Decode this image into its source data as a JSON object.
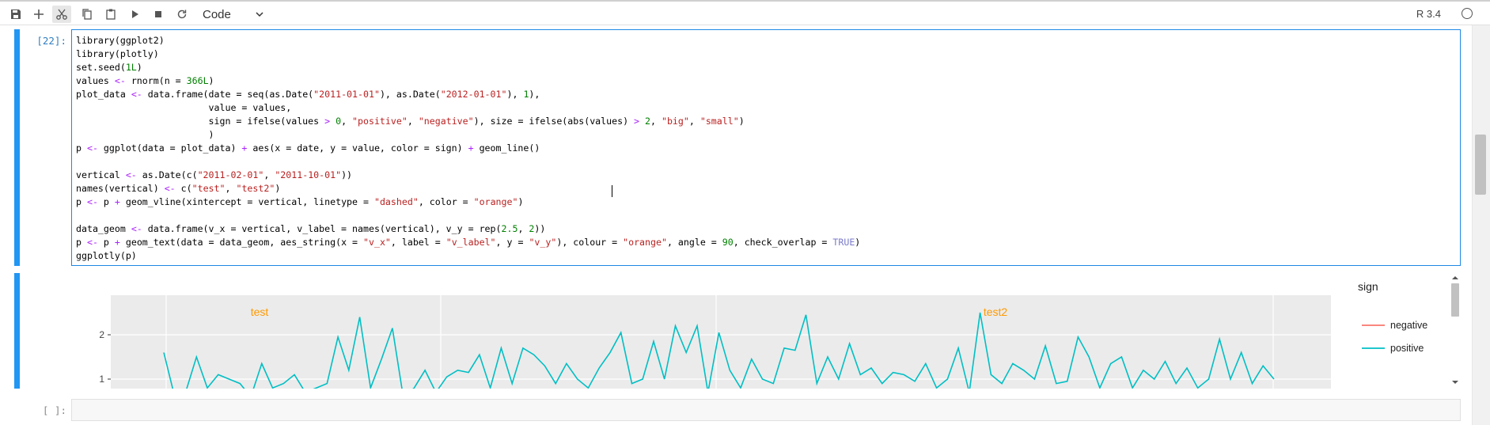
{
  "toolbar": {
    "buttons": [
      {
        "name": "save-icon"
      },
      {
        "name": "add-cell-icon"
      },
      {
        "name": "cut-icon"
      },
      {
        "name": "copy-icon"
      },
      {
        "name": "paste-icon"
      },
      {
        "name": "run-icon"
      },
      {
        "name": "stop-icon"
      },
      {
        "name": "restart-icon"
      }
    ],
    "cell_type": "Code",
    "kernel": "R 3.4"
  },
  "cells": [
    {
      "prompt": "[22]:",
      "code": [
        "library(ggplot2)",
        "library(plotly)",
        "set.seed(1L)",
        "values <- rnorm(n = 366L)",
        "plot_data <- data.frame(date = seq(as.Date(\"2011-01-01\"), as.Date(\"2012-01-01\"), 1),",
        "                        value = values,",
        "                        sign = ifelse(values > 0, \"positive\", \"negative\"), size = ifelse(abs(values) > 2, \"big\", \"small\")",
        "                        )",
        "p <- ggplot(data = plot_data) + aes(x = date, y = value, color = sign) + geom_line()",
        "",
        "vertical <- as.Date(c(\"2011-02-01\", \"2011-10-01\"))",
        "names(vertical) <- c(\"test\", \"test2\")",
        "p <- p + geom_vline(xintercept = vertical, linetype = \"dashed\", color = \"orange\")",
        "",
        "data_geom <- data.frame(v_x = vertical, v_label = names(vertical), v_y = rep(2.5, 2))",
        "p <- p + geom_text(data = data_geom, aes_string(x = \"v_x\", label = \"v_label\", y = \"v_y\"), colour = \"orange\", angle = 90, check_overlap = TRUE)",
        "ggplotly(p)"
      ]
    },
    {
      "prompt": "[ ]:"
    }
  ],
  "chart_data": {
    "type": "line",
    "legend_title": "sign",
    "legend_position": "right",
    "y_ticks": [
      1,
      2
    ],
    "series": [
      {
        "name": "negative",
        "color": "#f8766d",
        "values": []
      },
      {
        "name": "positive",
        "color": "#00bfc4",
        "values": [
          1.6,
          0.6,
          0.7,
          1.5,
          0.8,
          1.1,
          1.0,
          0.9,
          0.6,
          1.35,
          0.8,
          0.9,
          1.1,
          0.7,
          0.8,
          0.9,
          1.95,
          1.2,
          2.4,
          0.8,
          1.45,
          2.15,
          0.6,
          0.8,
          1.2,
          0.7,
          1.05,
          1.2,
          1.15,
          1.55,
          0.8,
          1.7,
          0.9,
          1.7,
          1.55,
          1.3,
          0.9,
          1.35,
          1.0,
          0.8,
          1.25,
          1.6,
          2.05,
          0.9,
          1.0,
          1.85,
          1.0,
          2.2,
          1.6,
          2.2,
          0.7,
          2.05,
          1.2,
          0.8,
          1.45,
          1.0,
          0.9,
          1.7,
          1.65,
          2.45,
          0.9,
          1.5,
          1.0,
          1.8,
          1.1,
          1.25,
          0.9,
          1.15,
          1.1,
          0.95,
          1.35,
          0.8,
          1.0,
          1.7,
          0.7,
          2.5,
          1.1,
          0.9,
          1.35,
          1.2,
          1.0,
          1.75,
          0.9,
          0.95,
          1.95,
          1.5,
          0.8,
          1.35,
          1.5,
          0.8,
          1.2,
          1.0,
          1.4,
          0.9,
          1.25,
          0.8,
          1.0,
          1.9,
          1.0,
          1.6,
          0.9,
          1.3,
          1.0
        ]
      }
    ],
    "annotations": [
      {
        "label": "test",
        "x": "2011-02-01",
        "color": "#ff9900"
      },
      {
        "label": "test2",
        "x": "2011-10-01",
        "color": "#ff9900"
      }
    ]
  }
}
